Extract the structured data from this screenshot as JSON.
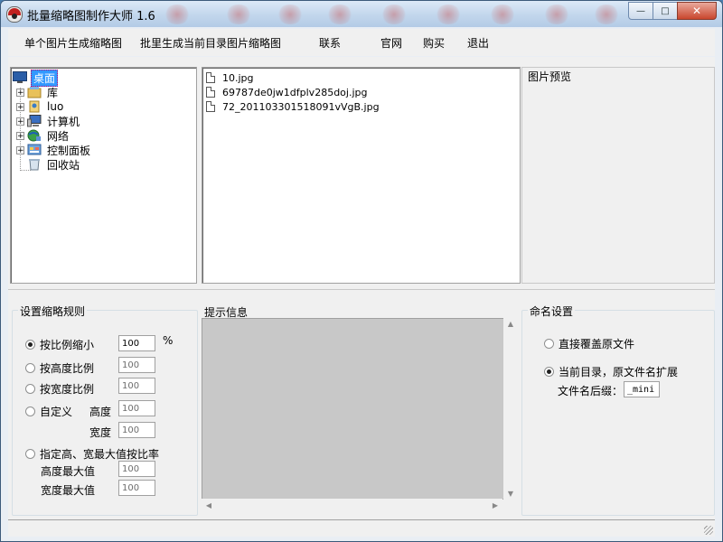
{
  "window": {
    "title": "批量缩略图制作大师 1.6",
    "controls": {
      "minimize": "—",
      "maximize": "□",
      "close": "✕"
    }
  },
  "menu": {
    "items": [
      "单个图片生成缩略图",
      "批里生成当前目录图片缩略图",
      "联系",
      "官网",
      "购买",
      "退出"
    ]
  },
  "tree": {
    "items": [
      {
        "label": "桌面",
        "icon": "desktop-icon",
        "selected": true
      },
      {
        "label": "库",
        "icon": "library-icon"
      },
      {
        "label": "luo",
        "icon": "user-icon"
      },
      {
        "label": "计算机",
        "icon": "computer-icon"
      },
      {
        "label": "网络",
        "icon": "network-icon"
      },
      {
        "label": "控制面板",
        "icon": "control-panel-icon"
      },
      {
        "label": "回收站",
        "icon": "recycle-bin-icon"
      }
    ]
  },
  "files": [
    "10.jpg",
    "69787de0jw1dfplv285doj.jpg",
    "72_201103301518091vVgB.jpg"
  ],
  "preview": {
    "title": "图片预览"
  },
  "rules": {
    "title": "设置缩略规则",
    "by_ratio": "按比例缩小",
    "ratio_value": "100",
    "percent": "%",
    "by_height_ratio": "按高度比例",
    "height_ratio_value": "100",
    "by_width_ratio": "按宽度比例",
    "width_ratio_value": "100",
    "custom": "自定义",
    "height_label": "高度",
    "height_value": "100",
    "width_label": "宽度",
    "width_value": "100",
    "max_ratio": "指定高、宽最大值按比率",
    "max_height_label": "高度最大值",
    "max_height_value": "100",
    "max_width_label": "宽度最大值",
    "max_width_value": "100"
  },
  "info": {
    "title": "提示信息"
  },
  "naming": {
    "title": "命名设置",
    "overwrite": "直接覆盖原文件",
    "extend": "当前目录，原文件名扩展",
    "suffix_label": "文件名后缀：",
    "suffix_value": "_mini"
  },
  "colors": {
    "selection": "#3399ff",
    "info_bg": "#c8c8c8",
    "client_bg": "#f0f0f0"
  }
}
